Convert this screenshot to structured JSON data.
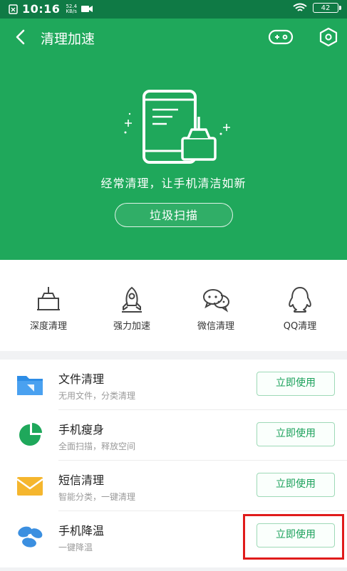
{
  "status": {
    "time": "10:16",
    "speed_value": "52.4",
    "speed_unit": "KB/s",
    "battery": "42"
  },
  "header": {
    "title": "清理加速"
  },
  "hero": {
    "slogan": "经常清理，让手机清洁如新",
    "scan_label": "垃圾扫描"
  },
  "quick_actions": [
    {
      "label": "深度清理",
      "icon": "broom-icon"
    },
    {
      "label": "强力加速",
      "icon": "rocket-icon"
    },
    {
      "label": "微信清理",
      "icon": "wechat-icon"
    },
    {
      "label": "QQ清理",
      "icon": "qq-icon"
    }
  ],
  "tools": [
    {
      "title": "文件清理",
      "subtitle": "无用文件，分类清理",
      "action": "立即使用",
      "icon": "folder-icon",
      "color": "#2d8de6"
    },
    {
      "title": "手机瘦身",
      "subtitle": "全面扫描，释放空间",
      "action": "立即使用",
      "icon": "pie-chart-icon",
      "color": "#1fa85b"
    },
    {
      "title": "短信清理",
      "subtitle": "智能分类，一键清理",
      "action": "立即使用",
      "icon": "envelope-icon",
      "color": "#f5b62e"
    },
    {
      "title": "手机降温",
      "subtitle": "一键降温",
      "action": "立即使用",
      "icon": "fan-icon",
      "color": "#3b8fe0"
    }
  ]
}
